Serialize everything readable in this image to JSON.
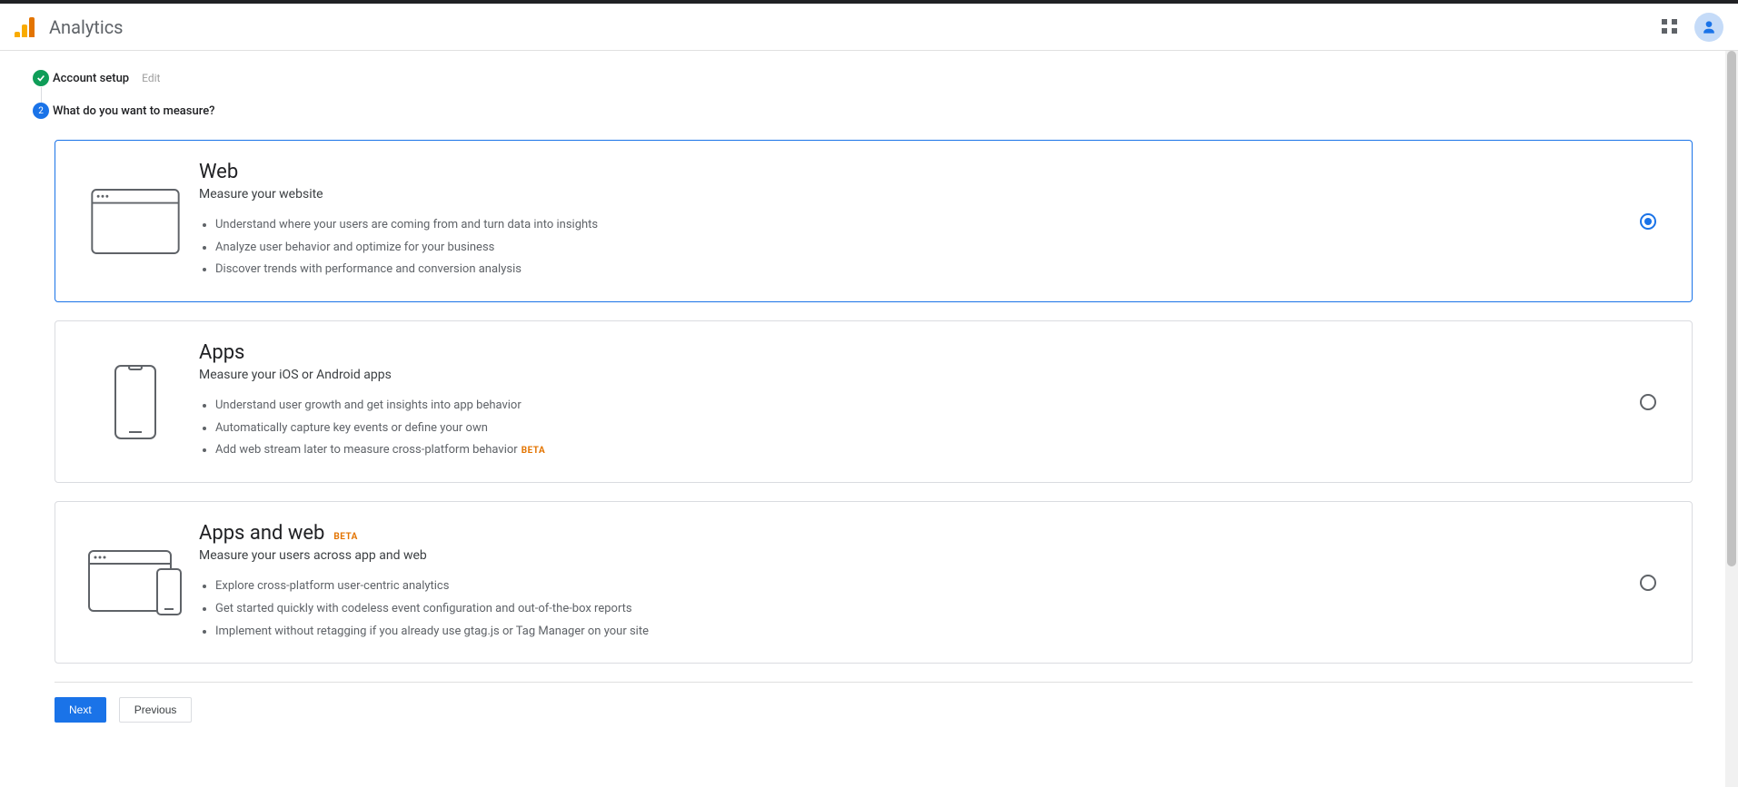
{
  "header": {
    "title": "Analytics"
  },
  "steps": {
    "step1": {
      "label": "Account setup",
      "edit": "Edit"
    },
    "step2": {
      "label": "What do you want to measure?",
      "number": "2"
    }
  },
  "options": {
    "web": {
      "title": "Web",
      "subtitle": "Measure your website",
      "bullet1": "Understand where your users are coming from and turn data into insights",
      "bullet2": "Analyze user behavior and optimize for your business",
      "bullet3": "Discover trends with performance and conversion analysis"
    },
    "apps": {
      "title": "Apps",
      "subtitle": "Measure your iOS or Android apps",
      "bullet1": "Understand user growth and get insights into app behavior",
      "bullet2": "Automatically capture key events or define your own",
      "bullet3": "Add web stream later to measure cross-platform behavior",
      "beta": "BETA"
    },
    "appsweb": {
      "title": "Apps and web",
      "beta": "BETA",
      "subtitle": "Measure your users across app and web",
      "bullet1": "Explore cross-platform user-centric analytics",
      "bullet2": "Get started quickly with codeless event configuration and out-of-the-box reports",
      "bullet3": "Implement without retagging if you already use gtag.js or Tag Manager on your site"
    }
  },
  "actions": {
    "next": "Next",
    "previous": "Previous"
  }
}
